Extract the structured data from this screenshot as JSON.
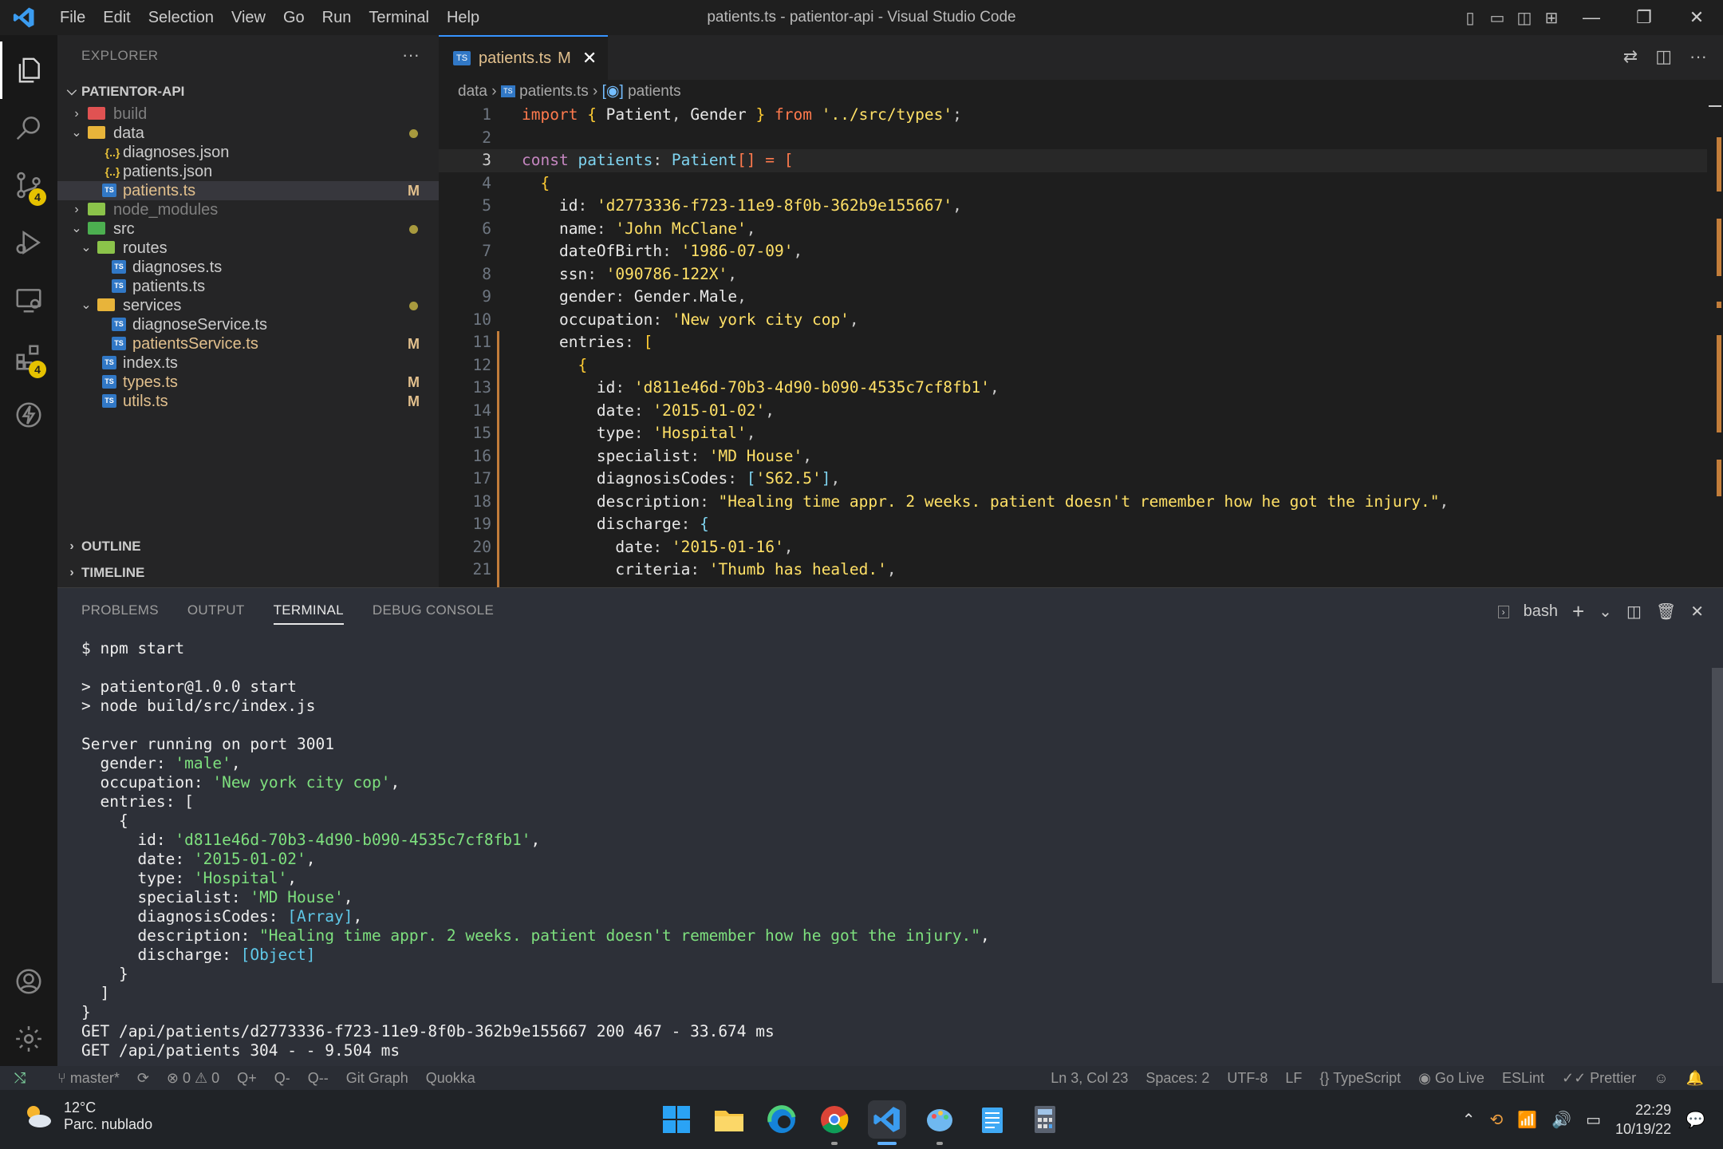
{
  "window": {
    "title": "patients.ts - patientor-api - Visual Studio Code",
    "menus": [
      "File",
      "Edit",
      "Selection",
      "View",
      "Go",
      "Run",
      "Terminal",
      "Help"
    ]
  },
  "activity": {
    "scm_badge": "4",
    "extensions_badge": "4"
  },
  "sidebar": {
    "title": "EXPLORER",
    "root": "PATIENTOR-API",
    "items": [
      {
        "label": "build",
        "level": 1,
        "kind": "folder",
        "icon_color": "#e05252",
        "collapsed": true,
        "dim": true
      },
      {
        "label": "data",
        "level": 1,
        "kind": "folder",
        "icon_color": "#e8b43a",
        "collapsed": false,
        "dot": true
      },
      {
        "label": "diagnoses.json",
        "level": 2,
        "kind": "json",
        "icon_color": "#e8c23a"
      },
      {
        "label": "patients.json",
        "level": 2,
        "kind": "json",
        "icon_color": "#e8c23a"
      },
      {
        "label": "patients.ts",
        "level": 2,
        "kind": "ts",
        "icon_color": "#3178c6",
        "status": "M",
        "selected": true
      },
      {
        "label": "node_modules",
        "level": 1,
        "kind": "folder",
        "icon_color": "#8bc34a",
        "collapsed": true,
        "dim": true
      },
      {
        "label": "src",
        "level": 1,
        "kind": "folder",
        "icon_color": "#4caf50",
        "collapsed": false,
        "dot": true
      },
      {
        "label": "routes",
        "level": 2,
        "kind": "folder",
        "icon_color": "#8bc34a",
        "collapsed": false
      },
      {
        "label": "diagnoses.ts",
        "level": 3,
        "kind": "ts",
        "icon_color": "#3178c6"
      },
      {
        "label": "patients.ts",
        "level": 3,
        "kind": "ts",
        "icon_color": "#3178c6"
      },
      {
        "label": "services",
        "level": 2,
        "kind": "folder",
        "icon_color": "#e8b43a",
        "collapsed": false,
        "dot": true
      },
      {
        "label": "diagnoseService.ts",
        "level": 3,
        "kind": "ts",
        "icon_color": "#3178c6"
      },
      {
        "label": "patientsService.ts",
        "level": 3,
        "kind": "ts",
        "icon_color": "#3178c6",
        "status": "M"
      },
      {
        "label": "index.ts",
        "level": 2,
        "kind": "ts",
        "icon_color": "#3178c6"
      },
      {
        "label": "types.ts",
        "level": 2,
        "kind": "ts",
        "icon_color": "#3178c6",
        "status": "M"
      },
      {
        "label": "utils.ts",
        "level": 2,
        "kind": "ts",
        "icon_color": "#3178c6",
        "status": "M"
      }
    ],
    "outline": "OUTLINE",
    "timeline": "TIMELINE"
  },
  "editor": {
    "tab_label": "patients.ts",
    "tab_status": "M",
    "breadcrumb": {
      "folder": "data",
      "file": "patients.ts",
      "symbol": "patients"
    },
    "current_line": 3,
    "lines": [
      {
        "n": "1",
        "tokens": [
          [
            "ck",
            "import "
          ],
          [
            "cb",
            "{ "
          ],
          [
            "cv",
            "Patient"
          ],
          [
            "p",
            ", "
          ],
          [
            "cv",
            "Gender "
          ],
          [
            "cb",
            "} "
          ],
          [
            "ck",
            "from "
          ],
          [
            "cs",
            "'../src/types'"
          ],
          [
            "p",
            ";"
          ]
        ]
      },
      {
        "n": "2",
        "tokens": []
      },
      {
        "n": "3",
        "tokens": [
          [
            "kw",
            "const "
          ],
          [
            "ct",
            "patients"
          ],
          [
            "p",
            ": "
          ],
          [
            "ct",
            "Patient"
          ],
          [
            "ck",
            "[] = "
          ],
          [
            "ck",
            "["
          ]
        ]
      },
      {
        "n": "4",
        "tokens": [
          [
            "cb",
            "  {"
          ]
        ]
      },
      {
        "n": "5",
        "tokens": [
          [
            "cv",
            "    id"
          ],
          [
            "p",
            ": "
          ],
          [
            "cs",
            "'d2773336-f723-11e9-8f0b-362b9e155667'"
          ],
          [
            "p",
            ","
          ]
        ]
      },
      {
        "n": "6",
        "tokens": [
          [
            "cv",
            "    name"
          ],
          [
            "p",
            ": "
          ],
          [
            "cs",
            "'John McClane'"
          ],
          [
            "p",
            ","
          ]
        ]
      },
      {
        "n": "7",
        "tokens": [
          [
            "cv",
            "    dateOfBirth"
          ],
          [
            "p",
            ": "
          ],
          [
            "cs",
            "'1986-07-09'"
          ],
          [
            "p",
            ","
          ]
        ]
      },
      {
        "n": "8",
        "tokens": [
          [
            "cv",
            "    ssn"
          ],
          [
            "p",
            ": "
          ],
          [
            "cs",
            "'090786-122X'"
          ],
          [
            "p",
            ","
          ]
        ]
      },
      {
        "n": "9",
        "tokens": [
          [
            "cv",
            "    gender"
          ],
          [
            "p",
            ": "
          ],
          [
            "cv",
            "Gender"
          ],
          [
            "p",
            "."
          ],
          [
            "cv",
            "Male"
          ],
          [
            "p",
            ","
          ]
        ]
      },
      {
        "n": "10",
        "tokens": [
          [
            "cv",
            "    occupation"
          ],
          [
            "p",
            ": "
          ],
          [
            "cs",
            "'New york city cop'"
          ],
          [
            "p",
            ","
          ]
        ]
      },
      {
        "n": "11",
        "tokens": [
          [
            "cv",
            "    entries"
          ],
          [
            "p",
            ": "
          ],
          [
            "cb",
            "["
          ]
        ]
      },
      {
        "n": "12",
        "tokens": [
          [
            "cb",
            "      {"
          ]
        ]
      },
      {
        "n": "13",
        "tokens": [
          [
            "cv",
            "        id"
          ],
          [
            "p",
            ": "
          ],
          [
            "cs",
            "'d811e46d-70b3-4d90-b090-4535c7cf8fb1'"
          ],
          [
            "p",
            ","
          ]
        ]
      },
      {
        "n": "14",
        "tokens": [
          [
            "cv",
            "        date"
          ],
          [
            "p",
            ": "
          ],
          [
            "cs",
            "'2015-01-02'"
          ],
          [
            "p",
            ","
          ]
        ]
      },
      {
        "n": "15",
        "tokens": [
          [
            "cv",
            "        type"
          ],
          [
            "p",
            ": "
          ],
          [
            "cs",
            "'Hospital'"
          ],
          [
            "p",
            ","
          ]
        ]
      },
      {
        "n": "16",
        "tokens": [
          [
            "cv",
            "        specialist"
          ],
          [
            "p",
            ": "
          ],
          [
            "cs",
            "'MD House'"
          ],
          [
            "p",
            ","
          ]
        ]
      },
      {
        "n": "17",
        "tokens": [
          [
            "cv",
            "        diagnosisCodes"
          ],
          [
            "p",
            ": "
          ],
          [
            "ct",
            "["
          ],
          [
            "cs",
            "'S62.5'"
          ],
          [
            "ct",
            "]"
          ],
          [
            "p",
            ","
          ]
        ]
      },
      {
        "n": "18",
        "tokens": [
          [
            "cv",
            "        description"
          ],
          [
            "p",
            ": "
          ],
          [
            "cs",
            "\"Healing time appr. 2 weeks. patient doesn't remember how he got the injury.\""
          ],
          [
            "p",
            ","
          ]
        ]
      },
      {
        "n": "19",
        "tokens": [
          [
            "cv",
            "        discharge"
          ],
          [
            "p",
            ": "
          ],
          [
            "ct",
            "{"
          ]
        ]
      },
      {
        "n": "20",
        "tokens": [
          [
            "cv",
            "          date"
          ],
          [
            "p",
            ": "
          ],
          [
            "cs",
            "'2015-01-16'"
          ],
          [
            "p",
            ","
          ]
        ]
      },
      {
        "n": "21",
        "tokens": [
          [
            "cv",
            "          criteria"
          ],
          [
            "p",
            ": "
          ],
          [
            "cs",
            "'Thumb has healed.'"
          ],
          [
            "p",
            ","
          ]
        ]
      }
    ]
  },
  "panel": {
    "tabs": [
      "PROBLEMS",
      "OUTPUT",
      "TERMINAL",
      "DEBUG CONSOLE"
    ],
    "active_tab": "TERMINAL",
    "shell": "bash",
    "terminal": [
      [
        [
          "w",
          "$ npm start"
        ]
      ],
      [
        [
          "w",
          ""
        ]
      ],
      [
        [
          "w",
          "> patientor@1.0.0 start"
        ]
      ],
      [
        [
          "w",
          "> node build/src/index.js"
        ]
      ],
      [
        [
          "w",
          ""
        ]
      ],
      [
        [
          "w",
          "Server running on port 3001"
        ]
      ],
      [
        [
          "w",
          "  gender: "
        ],
        [
          "tg",
          "'male'"
        ],
        [
          "w",
          ","
        ]
      ],
      [
        [
          "w",
          "  occupation: "
        ],
        [
          "tg",
          "'New york city cop'"
        ],
        [
          "w",
          ","
        ]
      ],
      [
        [
          "w",
          "  entries: ["
        ]
      ],
      [
        [
          "w",
          "    {"
        ]
      ],
      [
        [
          "w",
          "      id: "
        ],
        [
          "tg",
          "'d811e46d-70b3-4d90-b090-4535c7cf8fb1'"
        ],
        [
          "w",
          ","
        ]
      ],
      [
        [
          "w",
          "      date: "
        ],
        [
          "tg",
          "'2015-01-02'"
        ],
        [
          "w",
          ","
        ]
      ],
      [
        [
          "w",
          "      type: "
        ],
        [
          "tg",
          "'Hospital'"
        ],
        [
          "w",
          ","
        ]
      ],
      [
        [
          "w",
          "      specialist: "
        ],
        [
          "tg",
          "'MD House'"
        ],
        [
          "w",
          ","
        ]
      ],
      [
        [
          "w",
          "      diagnosisCodes: "
        ],
        [
          "tc",
          "[Array]"
        ],
        [
          "w",
          ","
        ]
      ],
      [
        [
          "w",
          "      description: "
        ],
        [
          "tg",
          "\"Healing time appr. 2 weeks. patient doesn't remember how he got the injury.\""
        ],
        [
          "w",
          ","
        ]
      ],
      [
        [
          "w",
          "      discharge: "
        ],
        [
          "tc",
          "[Object]"
        ]
      ],
      [
        [
          "w",
          "    }"
        ]
      ],
      [
        [
          "w",
          "  ]"
        ]
      ],
      [
        [
          "w",
          "}"
        ]
      ],
      [
        [
          "w",
          "GET /api/patients/d2773336-f723-11e9-8f0b-362b9e155667 200 467 - 33.674 ms"
        ]
      ],
      [
        [
          "w",
          "GET /api/patients 304 - - 9.504 ms"
        ]
      ]
    ]
  },
  "status": {
    "branch": "master*",
    "errors": "0",
    "warnings": "0",
    "quokka1": "Q+",
    "quokka2": "Q-",
    "quokka3": "Q--",
    "git_graph": "Git Graph",
    "quokka": "Quokka",
    "position": "Ln 3, Col 23",
    "spaces": "Spaces: 2",
    "encoding": "UTF-8",
    "eol": "LF",
    "language": "TypeScript",
    "go_live": "Go Live",
    "eslint": "ESLint",
    "prettier": "Prettier"
  },
  "taskbar": {
    "temp": "12°C",
    "weather": "Parc. nublado",
    "time": "22:29",
    "date": "10/19/22"
  }
}
